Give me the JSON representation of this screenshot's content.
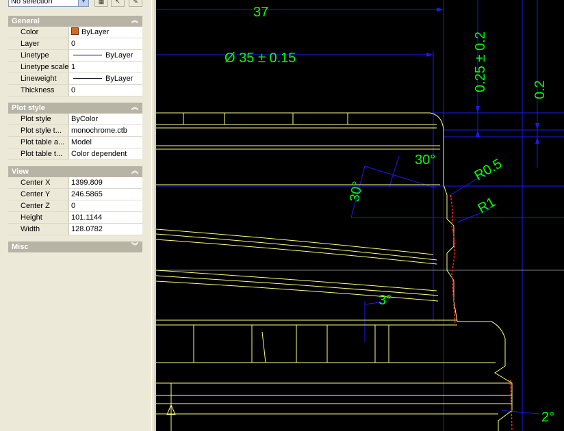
{
  "toolbar": {
    "selection_value": "No selection",
    "quick_select_icon": "quick-select-icon",
    "select_objects_icon": "select-objects-icon",
    "pickadd_icon": "pickadd-icon"
  },
  "sections": {
    "general": {
      "title": "General",
      "rows": [
        {
          "label": "Color",
          "value": "ByLayer",
          "swatch": "#d46a1d"
        },
        {
          "label": "Layer",
          "value": "0"
        },
        {
          "label": "Linetype",
          "value": "ByLayer"
        },
        {
          "label": "Linetype scale",
          "value": "1"
        },
        {
          "label": "Lineweight",
          "value": "ByLayer"
        },
        {
          "label": "Thickness",
          "value": "0"
        }
      ]
    },
    "plot_style": {
      "title": "Plot style",
      "rows": [
        {
          "label": "Plot style",
          "value": "ByColor"
        },
        {
          "label": "Plot style t...",
          "value": "monochrome.ctb"
        },
        {
          "label": "Plot table a...",
          "value": "Model"
        },
        {
          "label": "Plot table t...",
          "value": "Color dependent"
        }
      ]
    },
    "view": {
      "title": "View",
      "rows": [
        {
          "label": "Center X",
          "value": "1399.809"
        },
        {
          "label": "Center Y",
          "value": "246.5865"
        },
        {
          "label": "Center Z",
          "value": "0"
        },
        {
          "label": "Height",
          "value": "101.1144"
        },
        {
          "label": "Width",
          "value": "128.0782"
        }
      ]
    },
    "misc": {
      "title": "Misc"
    }
  },
  "drawing": {
    "background": "#000000",
    "dim_color": "#00ff00",
    "dimline_color": "#1a1aff",
    "geometry_color": "#ffff80",
    "hidden_color": "#ff2020",
    "dimensions": {
      "d37": "37",
      "d35": "Ø 35 ± 0.15",
      "d025": "0.25 ± 0.2",
      "d02": "0.2",
      "a30_top": "30°",
      "a30_left": "30°",
      "r05": "R0.5",
      "r1": "R1",
      "a3": "3°",
      "a2": "2°"
    }
  }
}
